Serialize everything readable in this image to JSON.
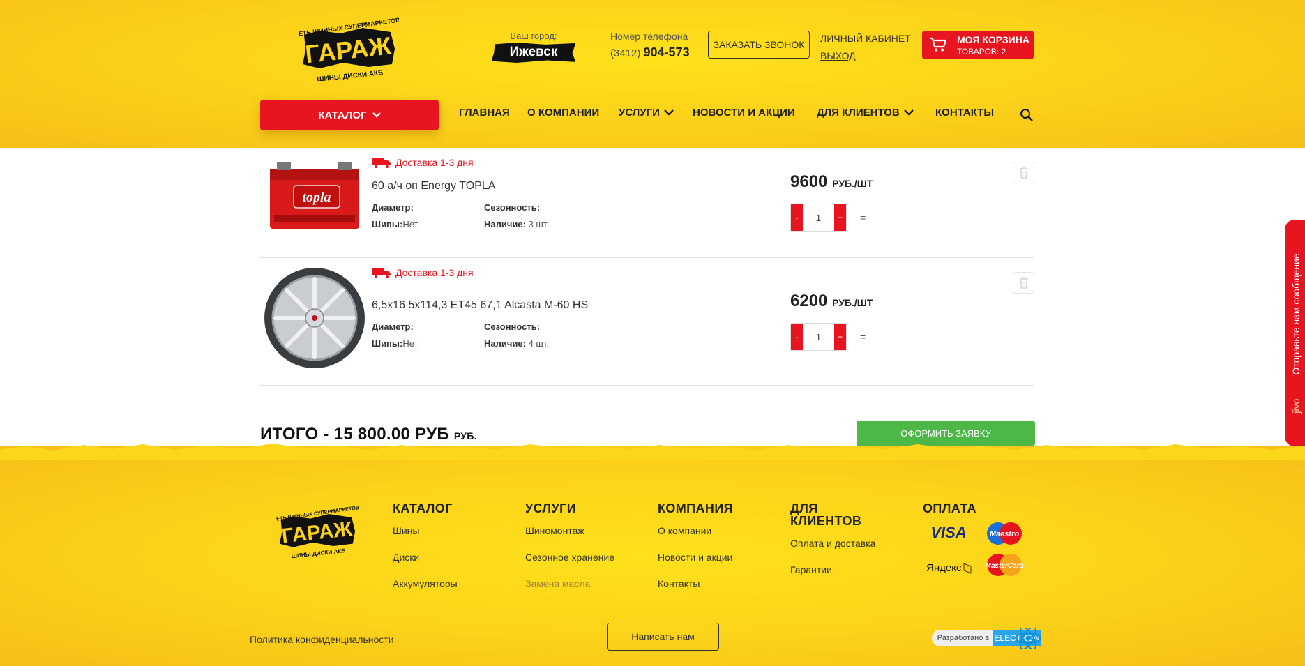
{
  "header": {
    "logo": {
      "top_text": "СЕТЬ ШИННЫХ СУПЕРМАРКЕТОВ",
      "name": "ГАРАЖ",
      "bottom_text": "ШИНЫ ДИСКИ АКБ"
    },
    "city_label": "Ваш город:",
    "city_name": "Ижевск",
    "phone_label": "Номер телефона",
    "phone_code": "(3412)",
    "phone_number": "904-573",
    "callback_label": "ЗАКАЗАТЬ ЗВОНОК",
    "account_label": "ЛИЧНЫЙ КАБИНЕТ",
    "logout_label": "ВЫХОД",
    "cart_title": "МОЯ КОРЗИНА",
    "cart_count": "ТОВАРОВ: 2",
    "catalog_label": "КАТАЛОГ",
    "nav": [
      {
        "label": "ГЛАВНАЯ"
      },
      {
        "label": "О КОМПАНИИ"
      },
      {
        "label": "УСЛУГИ"
      },
      {
        "label": "НОВОСТИ И АКЦИИ"
      },
      {
        "label": "ДЛЯ КЛИЕНТОВ"
      },
      {
        "label": "КОНТАКТЫ"
      }
    ]
  },
  "cart": {
    "items": [
      {
        "delivery": "Доставка 1-3 дня",
        "name": "60 а/ч оп Energy TOPLA",
        "image_text": "topla",
        "diameter_label": "Диаметр:",
        "season_label": "Сезонность:",
        "studs_label": "Шипы:",
        "studs_value": "Нет",
        "stock_label": "Наличие:",
        "stock_value": "3 шт.",
        "price": "9600",
        "unit": "РУБ./ШТ",
        "minus": "-",
        "qty": "1",
        "plus": "+",
        "eq": "="
      },
      {
        "delivery": "Доставка 1-3 дня",
        "name": "6,5x16 5x114,3 ET45 67,1 Alcasta M-60 HS",
        "diameter_label": "Диаметр:",
        "season_label": "Сезонность:",
        "studs_label": "Шипы:",
        "studs_value": "Нет",
        "stock_label": "Наличие:",
        "stock_value": "4 шт.",
        "price": "6200",
        "unit": "РУБ./ШТ",
        "minus": "-",
        "qty": "1",
        "plus": "+",
        "eq": "="
      }
    ],
    "total_text": "ИТОГО - 15 800.00 РУБ",
    "total_unit": "РУБ.",
    "order_label": "ОФОРМИТЬ ЗАЯВКУ"
  },
  "jivo": {
    "brand": "jivo",
    "text": "Отправьте нам сообщение"
  },
  "footer": {
    "columns": [
      {
        "title": "КАТАЛОГ",
        "links": [
          "Шины",
          "Диски",
          "Аккумуляторы"
        ]
      },
      {
        "title": "УСЛУГИ",
        "links": [
          "Шиномонтаж",
          "Сезонное хранение",
          "Замена масла"
        ]
      },
      {
        "title": "КОМПАНИЯ",
        "links": [
          "О компании",
          "Новости и акции",
          "Контакты"
        ]
      },
      {
        "title": "ДЛЯ КЛИЕНТОВ",
        "links": [
          "Оплата и доставка",
          "Гарантии"
        ]
      }
    ],
    "payment_title": "ОПЛАТА",
    "payment_logos": {
      "visa": "VISA",
      "maestro": "Maestro",
      "yandex": "Яндекс",
      "mastercard": "MasterCard"
    },
    "privacy": "Политика конфиденциальности",
    "write_label": "Написать нам",
    "dev_label": "Разработано в",
    "dev_brand": "ELECTRON"
  },
  "colors": {
    "brand_yellow": "#fcd31a",
    "brand_red": "#e8141f",
    "order_green": "#4db847"
  }
}
